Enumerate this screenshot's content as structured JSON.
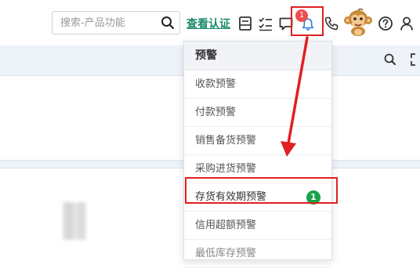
{
  "header": {
    "search_placeholder": "搜索-产品功能",
    "verify_link": "查看认证",
    "notification_count": "1"
  },
  "alerts_menu": {
    "title": "预警",
    "items": [
      {
        "label": "收款预警"
      },
      {
        "label": "付款预警"
      },
      {
        "label": "销售备货预警"
      },
      {
        "label": "采购进货预警"
      },
      {
        "label": "存货有效期预警",
        "count": "1"
      },
      {
        "label": "信用超额预警"
      },
      {
        "label": "最低库存预警"
      }
    ]
  },
  "colors": {
    "link": "#1a8a6b",
    "highlight_border": "#e02020",
    "bell_badge": "#ef4e4e",
    "count_badge": "#17a34a",
    "panel_band": "#eef3f9"
  },
  "icons": [
    "search-icon",
    "save-icon",
    "checklist-icon",
    "message-icon",
    "bell-icon",
    "phone-icon",
    "monkey-avatar",
    "help-icon",
    "user-icon",
    "expand-icon"
  ]
}
